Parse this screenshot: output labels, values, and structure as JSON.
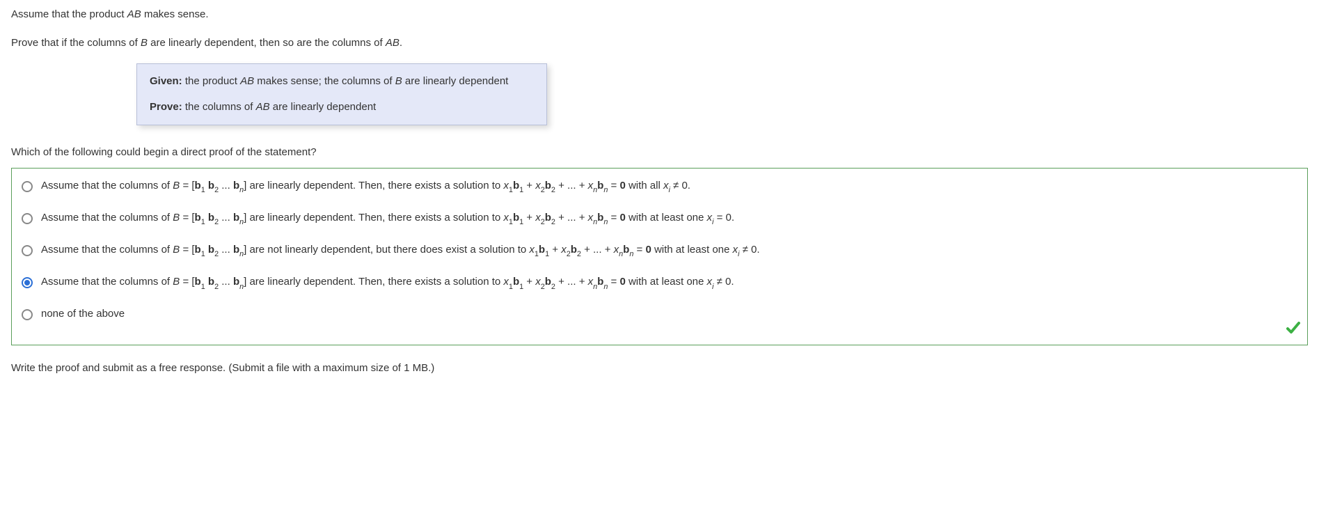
{
  "intro": {
    "line1_prefix": "Assume that the product ",
    "line1_ab": "AB",
    "line1_suffix": " makes sense.",
    "line2_prefix": "Prove that if the columns of ",
    "line2_b": "B",
    "line2_mid": " are linearly dependent, then so are the columns of ",
    "line2_ab": "AB",
    "line2_suffix": "."
  },
  "box": {
    "given_label": "Given:",
    "given_text_1": " the product ",
    "given_ab": "AB",
    "given_text_2": " makes sense; the columns of ",
    "given_b": "B",
    "given_text_3": " are linearly dependent",
    "prove_label": "Prove:",
    "prove_text_1": " the columns of ",
    "prove_ab": "AB",
    "prove_text_2": " are linearly dependent"
  },
  "question": "Which of the following could begin a direct proof of the statement?",
  "options": {
    "o1": {
      "prefix": "Assume that the columns of ",
      "B": "B",
      "eq": " = [",
      "mid1": "] are linearly dependent. Then, there exists a solution to ",
      "eq2": " = ",
      "zero": "0",
      "tail": " with all ",
      "xi": "x",
      "i": "i",
      "neq": " ≠ 0."
    },
    "o2": {
      "prefix": "Assume that the columns of ",
      "B": "B",
      "eq": " = [",
      "mid1": "] are linearly dependent. Then, there exists a solution to ",
      "eq2": " = ",
      "zero": "0",
      "tail": " with at least one ",
      "xi": "x",
      "i": "i",
      "suffix": " = 0."
    },
    "o3": {
      "prefix": "Assume that the columns of ",
      "B": "B",
      "eq": " = [",
      "mid1": "] are not linearly dependent, but there does exist a solution to ",
      "eq2": " = ",
      "zero": "0",
      "tail": " with at least one ",
      "xi": "x",
      "i": "i",
      "neq": " ≠ 0."
    },
    "o4": {
      "prefix": "Assume that the columns of ",
      "B": "B",
      "eq": " = [",
      "mid1": "] are linearly dependent. Then, there exists a solution to ",
      "eq2": " = ",
      "zero": "0",
      "tail": " with at least one ",
      "xi": "x",
      "i": "i",
      "neq": " ≠ 0."
    },
    "o5": "none of the above"
  },
  "math": {
    "b1": "b",
    "s1": "1",
    "b2": "b",
    "s2": "2",
    "dots": " ... ",
    "bn": "b",
    "sn": "n",
    "x1": "x",
    "sx1": "1",
    "x2": "x",
    "sx2": "2",
    "xn": "x",
    "sxn": "n",
    "plus": " + ",
    "plusdots": " + ... + "
  },
  "free_response": "Write the proof and submit as a free response. (Submit a file with a maximum size of 1 MB.)"
}
